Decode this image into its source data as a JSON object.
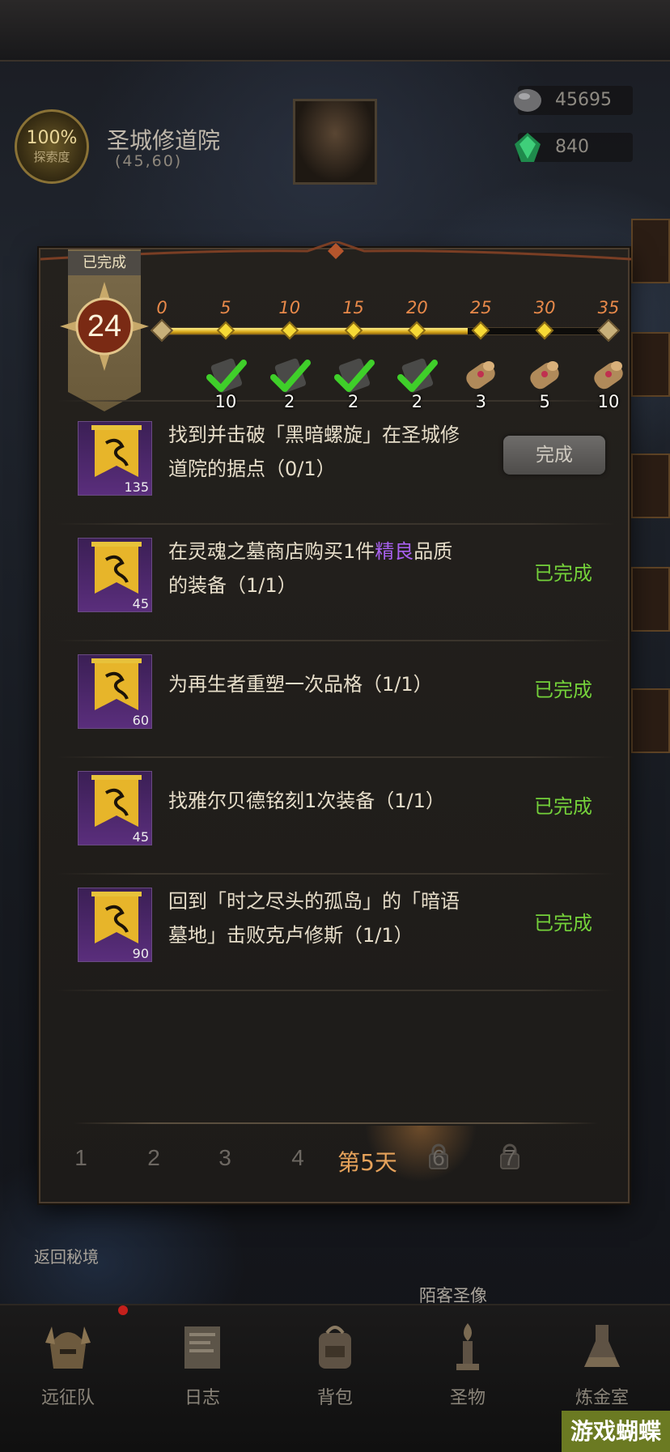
{
  "header": {
    "exploration_pct": "100%",
    "exploration_label": "探索度",
    "location_name": "圣城修道院",
    "location_coord": "(45,60)",
    "resource1_value": "45695",
    "resource2_value": "840"
  },
  "dialog": {
    "completed_ribbon": "已完成",
    "points": "24",
    "progress": {
      "current": 24,
      "max": 35,
      "milestones": [
        {
          "label": "0",
          "reward": null
        },
        {
          "label": "5",
          "reward": "10",
          "claimed": true
        },
        {
          "label": "10",
          "reward": "2",
          "claimed": true
        },
        {
          "label": "15",
          "reward": "2",
          "claimed": true
        },
        {
          "label": "20",
          "reward": "2",
          "claimed": true
        },
        {
          "label": "25",
          "reward": "3",
          "claimed": false
        },
        {
          "label": "30",
          "reward": "5",
          "claimed": false
        },
        {
          "label": "35",
          "reward": "10",
          "claimed": false
        }
      ]
    },
    "tasks": [
      {
        "count": "135",
        "text_a": "找到并击破「黑暗螺旋」在圣城修",
        "text_b": "道院的据点（0/1）",
        "status": "完成",
        "is_button": true
      },
      {
        "count": "45",
        "text_a_pre": "在灵魂之墓商店购买1件",
        "text_a_hl": "精良",
        "text_a_post": "品质",
        "text_b": "的装备（1/1）",
        "status": "已完成",
        "is_button": false
      },
      {
        "count": "60",
        "text_a": "为再生者重塑一次品格（1/1）",
        "text_b": "",
        "status": "已完成",
        "is_button": false
      },
      {
        "count": "45",
        "text_a": "找雅尔贝德铭刻1次装备（1/1）",
        "text_b": "",
        "status": "已完成",
        "is_button": false
      },
      {
        "count": "90",
        "text_a": "回到「时之尽头的孤岛」的「暗语",
        "text_b": "墓地」击败克卢修斯（1/1）",
        "status": "已完成",
        "is_button": false
      }
    ],
    "day_tabs": [
      {
        "label": "1",
        "locked": false
      },
      {
        "label": "2",
        "locked": false
      },
      {
        "label": "3",
        "locked": false
      },
      {
        "label": "4",
        "locked": false
      },
      {
        "label": "第5天",
        "locked": false,
        "active": true
      },
      {
        "label": "6",
        "locked": true
      },
      {
        "label": "7",
        "locked": true
      }
    ]
  },
  "scene": {
    "return_label": "返回秘境",
    "statue_label": "陌客圣像"
  },
  "bottom_nav": [
    {
      "label": "远征队",
      "icon": "helmet-icon"
    },
    {
      "label": "日志",
      "icon": "journal-icon"
    },
    {
      "label": "背包",
      "icon": "backpack-icon"
    },
    {
      "label": "圣物",
      "icon": "relic-icon"
    },
    {
      "label": "炼金室",
      "icon": "alchemy-icon"
    }
  ],
  "watermark": "游戏蝴蝶",
  "colors": {
    "completed_green": "#74d13a",
    "milestone_orange": "#e8894a",
    "active_tab": "#e6a25a",
    "highlight_purple": "#a860f0"
  }
}
